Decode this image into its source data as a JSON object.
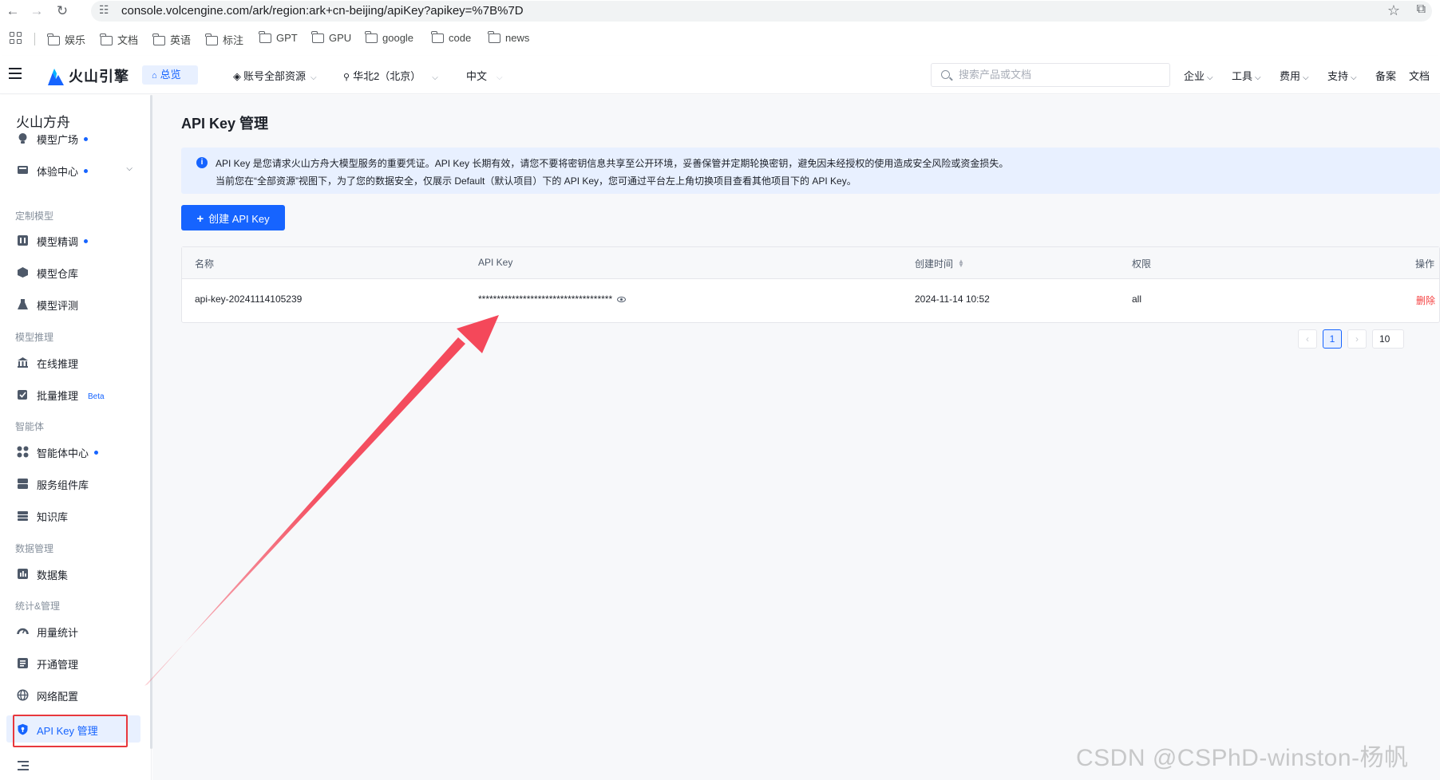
{
  "browser": {
    "url": "console.volcengine.com/ark/region:ark+cn-beijing/apiKey?apikey=%7B%7D",
    "bookmarks": [
      "娱乐",
      "文档",
      "英语",
      "标注",
      "GPT",
      "GPU",
      "google",
      "code",
      "news"
    ]
  },
  "topbar": {
    "logo_text": "火山引擎",
    "home_label": "总览",
    "resource_label": "账号全部资源",
    "region_label": "华北2（北京）",
    "language_label": "中文",
    "search_placeholder": "搜索产品或文档",
    "links": [
      "企业",
      "工具",
      "费用",
      "支持",
      "备案",
      "文档"
    ]
  },
  "sidebar": {
    "title": "火山方舟",
    "groups": [
      "定制模型",
      "模型推理",
      "智能体",
      "数据管理",
      "统计&管理"
    ],
    "items": [
      {
        "label": "模型广场",
        "icon": "lightbulb-icon"
      },
      {
        "label": "体验中心",
        "icon": "monitor-icon"
      },
      {
        "label": "模型精调",
        "icon": "tune-icon"
      },
      {
        "label": "模型仓库",
        "icon": "cube-icon"
      },
      {
        "label": "模型评测",
        "icon": "flask-icon"
      },
      {
        "label": "在线推理",
        "icon": "bank-icon"
      },
      {
        "label": "批量推理",
        "icon": "batch-icon"
      },
      {
        "label": "Beta"
      },
      {
        "label": "智能体中心",
        "icon": "apps-icon"
      },
      {
        "label": "服务组件库",
        "icon": "stack-icon"
      },
      {
        "label": "知识库",
        "icon": "database-icon"
      },
      {
        "label": "数据集",
        "icon": "dataset-icon"
      },
      {
        "label": "用量统计",
        "icon": "gauge-icon"
      },
      {
        "label": "开通管理",
        "icon": "list-icon"
      },
      {
        "label": "网络配置",
        "icon": "globe-icon"
      },
      {
        "label": "API Key 管理",
        "icon": "shield-key-icon"
      }
    ]
  },
  "main": {
    "title": "API Key 管理",
    "notice_line1": "API Key 是您请求火山方舟大模型服务的重要凭证。API Key 长期有效，请您不要将密钥信息共享至公开环境，妥善保管并定期轮换密钥，避免因未经授权的使用造成安全风险或资金损失。",
    "notice_line2": "当前您在“全部资源”视图下，为了您的数据安全，仅展示 Default（默认项目）下的 API Key，您可通过平台左上角切换项目查看其他项目下的 API Key。",
    "create_button": "创建 API Key",
    "table": {
      "columns": [
        "名称",
        "API Key",
        "创建时间",
        "权限",
        "操作"
      ],
      "rows": [
        {
          "name": "api-key-20241114105239",
          "key": "************************************",
          "created": "2024-11-14 10:52",
          "permission": "all",
          "action": "删除"
        }
      ]
    },
    "pagination": {
      "prev": "‹",
      "current": "1",
      "next": "›",
      "page_size": "10"
    }
  },
  "watermark": "CSDN @CSPhD-winston-杨帆",
  "colors": {
    "accent": "#1664ff",
    "danger": "#f53f3f",
    "annotation": "#f4485a"
  }
}
